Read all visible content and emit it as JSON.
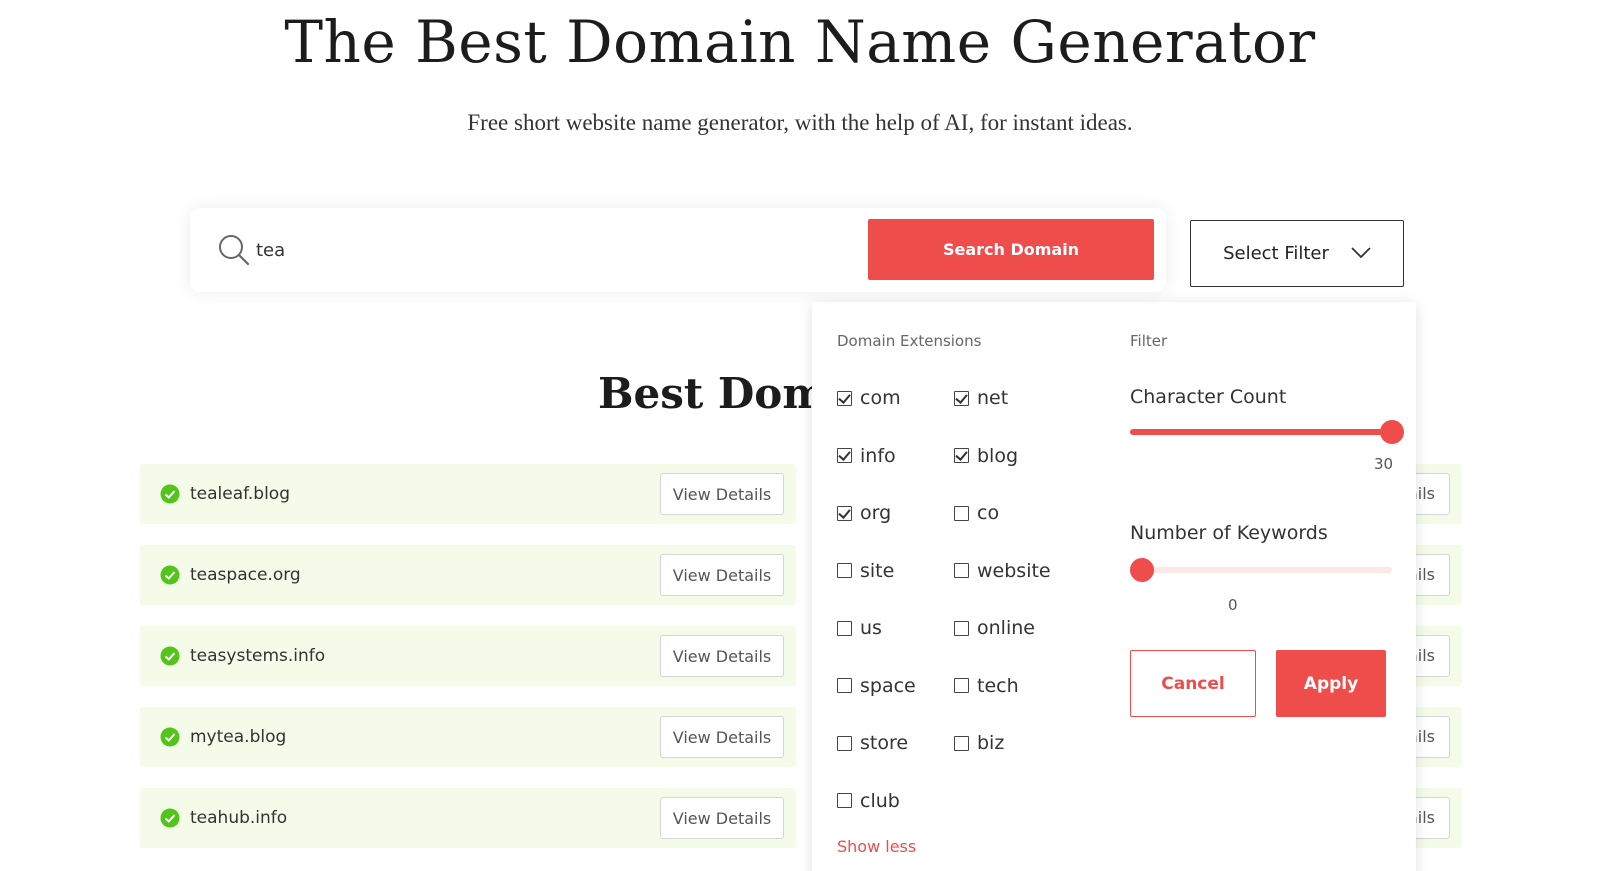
{
  "hero": {
    "title": "The Best Domain Name Generator",
    "subtitle": "Free short website name generator, with the help of AI, for instant ideas."
  },
  "search": {
    "query": "tea",
    "button_label": "Search Domain",
    "icon": "search-icon"
  },
  "filter": {
    "button_label": "Select Filter",
    "icon": "chevron-down-icon"
  },
  "results": {
    "section_title": "Best Doma",
    "view_details_label": "View Details",
    "partial_details_label": "ails",
    "status_icon": "check-circle-icon",
    "status_color": "#52c41a",
    "rows": [
      {
        "name": "tealeaf.blog"
      },
      {
        "name": "teaspace.org"
      },
      {
        "name": "teasystems.info"
      },
      {
        "name": "mytea.blog"
      },
      {
        "name": "teahub.info"
      }
    ]
  },
  "dropdown": {
    "extensions_heading": "Domain Extensions",
    "filter_heading": "Filter",
    "extensions": [
      {
        "label": "com",
        "checked": true
      },
      {
        "label": "net",
        "checked": true
      },
      {
        "label": "info",
        "checked": true
      },
      {
        "label": "blog",
        "checked": true
      },
      {
        "label": "org",
        "checked": true
      },
      {
        "label": "co",
        "checked": false
      },
      {
        "label": "site",
        "checked": false
      },
      {
        "label": "website",
        "checked": false
      },
      {
        "label": "us",
        "checked": false
      },
      {
        "label": "online",
        "checked": false
      },
      {
        "label": "space",
        "checked": false
      },
      {
        "label": "tech",
        "checked": false
      },
      {
        "label": "store",
        "checked": false
      },
      {
        "label": "biz",
        "checked": false
      },
      {
        "label": "club",
        "checked": false
      }
    ],
    "show_less_label": "Show less",
    "character_count": {
      "label": "Character Count",
      "value": "30",
      "fraction": 1.0
    },
    "keywords": {
      "label": "Number of Keywords",
      "value": "0",
      "fraction": 0.0
    },
    "cancel_label": "Cancel",
    "apply_label": "Apply"
  },
  "colors": {
    "accent": "#ef4d4b",
    "row_background": "#f4fbe9"
  }
}
